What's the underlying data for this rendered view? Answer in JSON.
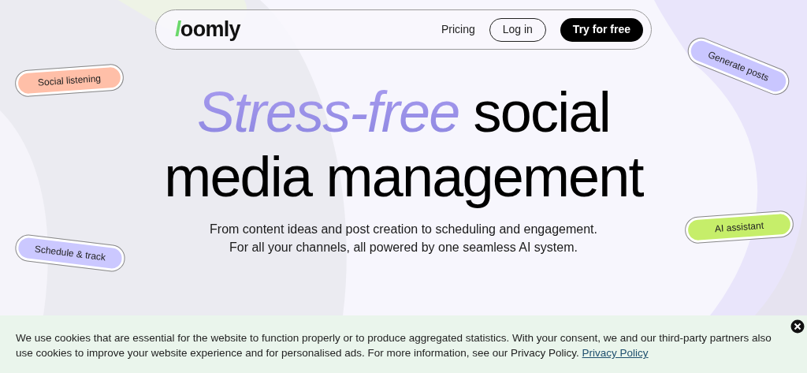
{
  "nav": {
    "logo": "loomly",
    "links": [
      {
        "label": "Pricing",
        "kind": "link"
      },
      {
        "label": "Log in",
        "kind": "outline"
      },
      {
        "label": "Try for free",
        "kind": "solid"
      }
    ]
  },
  "pills": [
    {
      "label": "Social listening",
      "color": "#ffbfa8"
    },
    {
      "label": "Generate posts",
      "color": "#c9c6ff"
    },
    {
      "label": "Schedule & track",
      "color": "#cbc8ff"
    },
    {
      "label": "AI assistant",
      "color": "#c6ee6a"
    }
  ],
  "headline": {
    "highlight": "Stress-free",
    "text": "social media management"
  },
  "subtitle": [
    "From content ideas and post creation to scheduling and engagement.",
    "For all your channels, all powered by one seamless AI system."
  ],
  "cookie_banner": {
    "text": "We use cookies that are essential for the website to function properly or to produce aggregated statistics. With your consent, we and our third-party partners also use cookies to improve your website experience and for personalised ads. For more information, see our Privacy Policy.",
    "link": "Privacy Policy"
  }
}
